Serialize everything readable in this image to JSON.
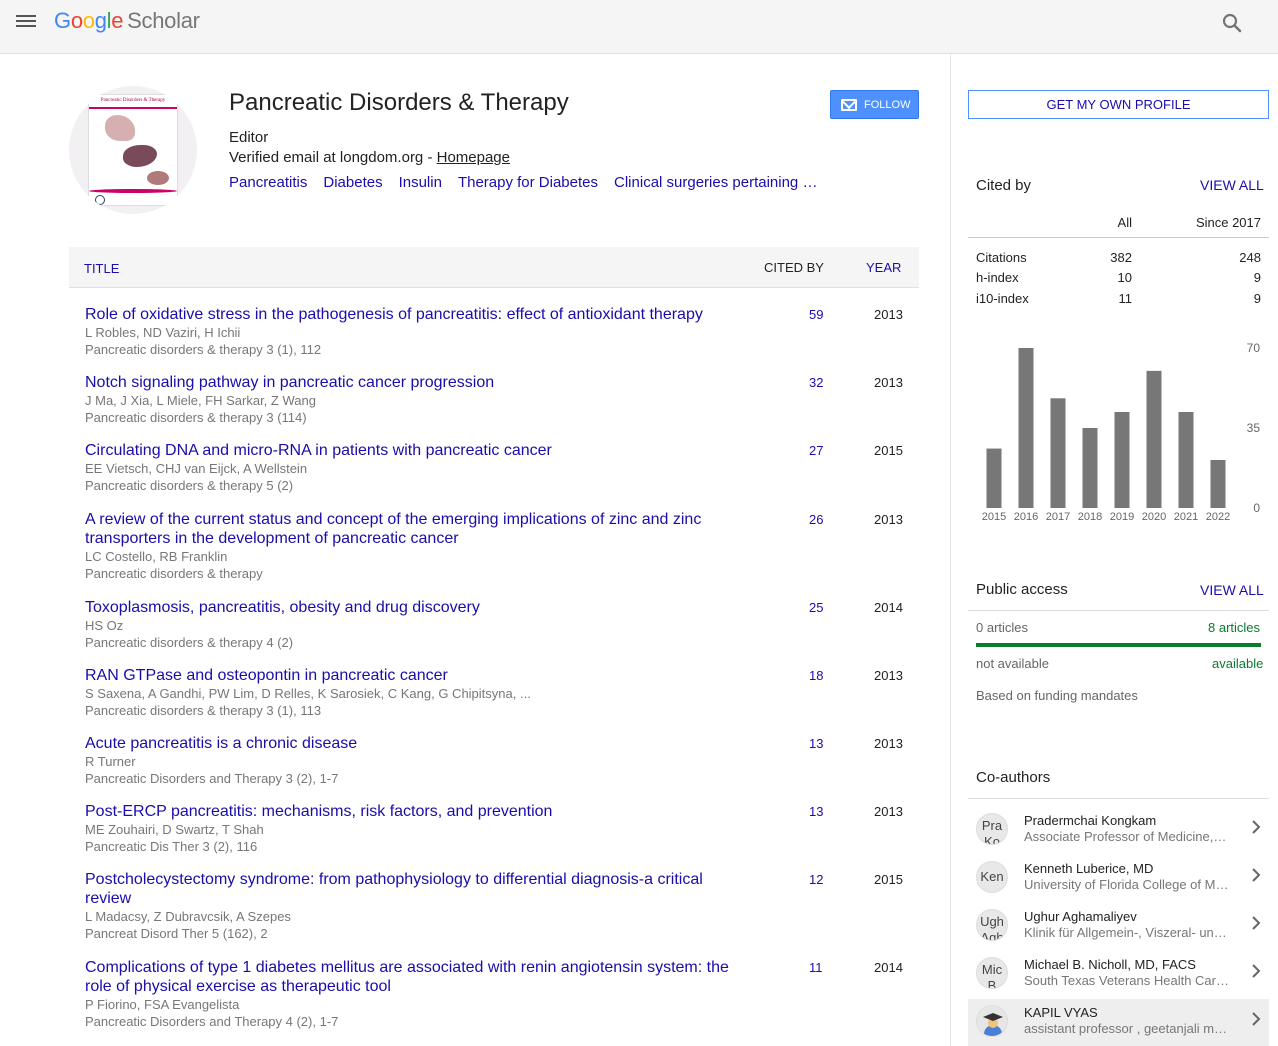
{
  "header": {
    "logo_letters": [
      "G",
      "o",
      "o",
      "g",
      "l",
      "e"
    ],
    "logo_suffix": "Scholar",
    "search_icon": "search-icon",
    "menu_icon": "hamburger-menu-icon"
  },
  "profile": {
    "name": "Pancreatic Disorders & Therapy",
    "role": "Editor",
    "email_text": "Verified email at longdom.org - ",
    "homepage_label": "Homepage",
    "interests": [
      "Pancreatitis",
      "Diabetes",
      "Insulin",
      "Therapy for Diabetes",
      "Clinical surgeries pertaining …"
    ],
    "follow_label": "FOLLOW",
    "avatar_cover_title": "Pancreatic Disorders & Therapy"
  },
  "table": {
    "title_header": "TITLE",
    "cited_header": "CITED BY",
    "year_header": "YEAR",
    "articles": [
      {
        "title": "Role of oxidative stress in the pathogenesis of pancreatitis: effect of antioxidant therapy",
        "authors": "L Robles, ND Vaziri, H Ichii",
        "venue": "Pancreatic disorders & therapy 3 (1), 112",
        "cited": "59",
        "year": "2013"
      },
      {
        "title": "Notch signaling pathway in pancreatic cancer progression",
        "authors": "J Ma, J Xia, L Miele, FH Sarkar, Z Wang",
        "venue": "Pancreatic disorders & therapy 3 (114)",
        "cited": "32",
        "year": "2013"
      },
      {
        "title": "Circulating DNA and micro-RNA in patients with pancreatic cancer",
        "authors": "EE Vietsch, CHJ van Eijck, A Wellstein",
        "venue": "Pancreatic disorders & therapy 5 (2)",
        "cited": "27",
        "year": "2015"
      },
      {
        "title": "A review of the current status and concept of the emerging implications of zinc and zinc transporters in the development of pancreatic cancer",
        "authors": "LC Costello, RB Franklin",
        "venue": "Pancreatic disorders & therapy",
        "cited": "26",
        "year": "2013"
      },
      {
        "title": "Toxoplasmosis, pancreatitis, obesity and drug discovery",
        "authors": "HS Oz",
        "venue": "Pancreatic disorders & therapy 4 (2)",
        "cited": "25",
        "year": "2014"
      },
      {
        "title": "RAN GTPase and osteopontin in pancreatic cancer",
        "authors": "S Saxena, A Gandhi, PW Lim, D Relles, K Sarosiek, C Kang, G Chipitsyna, ...",
        "venue": "Pancreatic disorders & therapy 3 (1), 113",
        "cited": "18",
        "year": "2013"
      },
      {
        "title": "Acute pancreatitis is a chronic disease",
        "authors": "R Turner",
        "venue": "Pancreatic Disorders and Therapy 3 (2), 1-7",
        "cited": "13",
        "year": "2013"
      },
      {
        "title": "Post-ERCP pancreatitis: mechanisms, risk factors, and prevention",
        "authors": "ME Zouhairi, D Swartz, T Shah",
        "venue": "Pancreatic Dis Ther 3 (2), 116",
        "cited": "13",
        "year": "2013"
      },
      {
        "title": "Postcholecystectomy syndrome: from pathophysiology to differential diagnosis-a critical review",
        "authors": "L Madacsy, Z Dubravcsik, A Szepes",
        "venue": "Pancreat Disord Ther 5 (162), 2",
        "cited": "12",
        "year": "2015"
      },
      {
        "title": "Complications of type 1 diabetes mellitus are associated with renin angiotensin system: the role of physical exercise as therapeutic tool",
        "authors": "P Fiorino, FSA Evangelista",
        "venue": "Pancreatic Disorders and Therapy 4 (2), 1-7",
        "cited": "11",
        "year": "2014"
      }
    ]
  },
  "sidebar": {
    "get_profile_label": "GET MY OWN PROFILE",
    "cited_by": {
      "title": "Cited by",
      "view_all": "VIEW ALL",
      "col_all": "All",
      "col_since": "Since 2017",
      "rows": [
        {
          "label": "Citations",
          "all": "382",
          "since": "248"
        },
        {
          "label": "h-index",
          "all": "10",
          "since": "9"
        },
        {
          "label": "i10-index",
          "all": "11",
          "since": "9"
        }
      ]
    },
    "chart_data": {
      "type": "bar",
      "title": "",
      "xlabel": "",
      "ylabel": "",
      "categories": [
        "2015",
        "2016",
        "2017",
        "2018",
        "2019",
        "2020",
        "2021",
        "2022"
      ],
      "values": [
        26,
        70,
        48,
        35,
        42,
        60,
        42,
        21
      ],
      "ylim": [
        0,
        70
      ],
      "yticks": [
        "70",
        "35",
        "0"
      ],
      "bar_color": "#777777",
      "grid": false
    },
    "public_access": {
      "title": "Public access",
      "view_all": "VIEW ALL",
      "left_count": "0 articles",
      "right_count": "8 articles",
      "left_status": "not available",
      "right_status": "available",
      "note": "Based on funding mandates",
      "available_fraction": 1.0,
      "accent": "#0b7b30"
    },
    "coauthors": {
      "title": "Co-authors",
      "items": [
        {
          "initials": "Pra Ko",
          "name": "Pradermchai Kongkam",
          "affil": "Associate Professor of Medicine, Chulalongkorn University"
        },
        {
          "initials": "Ken",
          "name": "Kenneth Luberice, MD",
          "affil": "University of Florida College of Medicine"
        },
        {
          "initials": "Ugh Agh",
          "name": "Ughur Aghamaliyev",
          "affil": "Klinik für Allgemein-, Viszeral- und Transplantationschirurgie"
        },
        {
          "initials": "Mic B",
          "name": "Michael B. Nicholl, MD, FACS",
          "affil": "South Texas Veterans Health Care System"
        },
        {
          "initials": "",
          "name": "KAPIL VYAS",
          "affil": "assistant professor , geetanjali medical college"
        }
      ]
    }
  }
}
